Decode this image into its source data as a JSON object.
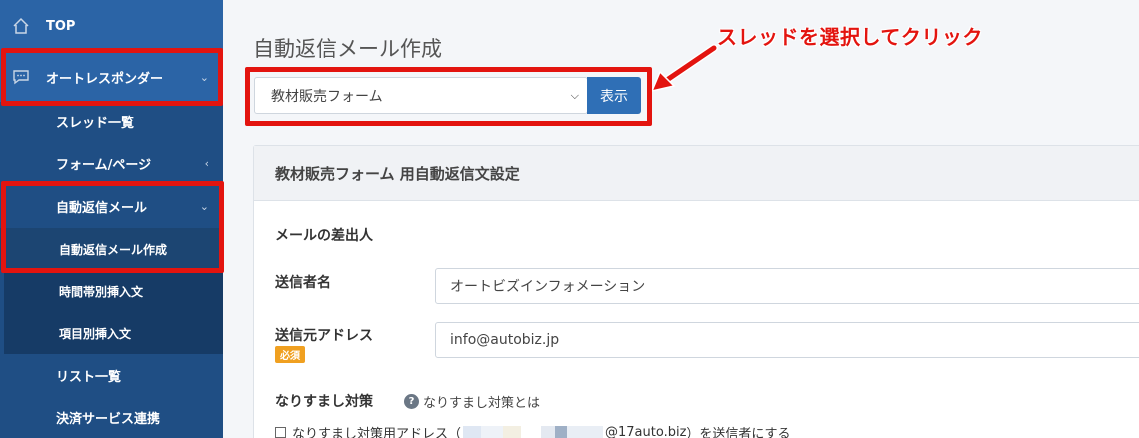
{
  "sidebar": {
    "top": "TOP",
    "autoresponder": "オートレスポンダー",
    "threads": "スレッド一覧",
    "forms": "フォーム/ページ",
    "auto_reply": "自動返信メール",
    "auto_reply_create": "自動返信メール作成",
    "time_insert": "時間帯別挿入文",
    "item_insert": "項目別挿入文",
    "list": "リスト一覧",
    "payment": "決済サービス連携"
  },
  "main": {
    "title": "自動返信メール作成",
    "callout": "スレッドを選択してクリック",
    "select_value": "教材販売フォーム",
    "show_button": "表示",
    "card_title": "教材販売フォーム 用自動返信文設定",
    "sender_section": "メールの差出人",
    "sender_name_label": "送信者名",
    "sender_name_value": "オートビズインフォメーション",
    "sender_addr_label": "送信元アドレス",
    "required_badge": "必須",
    "sender_addr_value": "info@autobiz.jp",
    "spoof_title": "なりすまし対策",
    "spoof_help": "なりすまし対策とは",
    "spoof_check_prefix": "なりすまし対策用アドレス（",
    "spoof_check_domain": "@17auto.biz",
    "spoof_check_suffix": "）を送信者にする"
  },
  "colors": {
    "sidebar_bg": "#1f4e84",
    "sidebar_active": "#2b64a6",
    "highlight_red": "#e3140f",
    "button_blue": "#2f6fb6",
    "badge_orange": "#f0a020"
  }
}
